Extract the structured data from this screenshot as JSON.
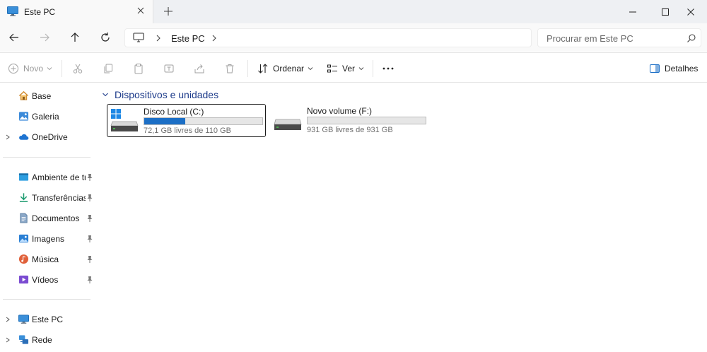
{
  "window": {
    "tab_title": "Este PC",
    "tab_icon": "this-pc-icon",
    "new_tab_label": "+"
  },
  "nav": {
    "breadcrumb": [
      "Este PC"
    ],
    "search_placeholder": "Procurar em Este PC"
  },
  "commands": {
    "new": "Novo",
    "sort": "Ordenar",
    "view": "Ver",
    "details": "Detalhes"
  },
  "sidebar": {
    "top": [
      {
        "label": "Base",
        "icon": "home-icon"
      },
      {
        "label": "Galeria",
        "icon": "gallery-icon"
      },
      {
        "label": "OneDrive",
        "icon": "onedrive-icon",
        "expandable": true
      }
    ],
    "pinned": [
      {
        "label": "Ambiente de trabalho",
        "icon": "desktop-icon"
      },
      {
        "label": "Transferências",
        "icon": "downloads-icon"
      },
      {
        "label": "Documentos",
        "icon": "documents-icon"
      },
      {
        "label": "Imagens",
        "icon": "pictures-icon"
      },
      {
        "label": "Música",
        "icon": "music-icon"
      },
      {
        "label": "Vídeos",
        "icon": "videos-icon"
      }
    ],
    "bottom": [
      {
        "label": "Este PC",
        "icon": "this-pc-icon",
        "expandable": true
      },
      {
        "label": "Rede",
        "icon": "network-icon",
        "expandable": true
      }
    ]
  },
  "main": {
    "group_title": "Dispositivos e unidades",
    "drives": [
      {
        "name": "Disco Local (C:)",
        "free_text": "72,1 GB livres de 110 GB",
        "used_fraction": 0.345,
        "selected": true,
        "system": true
      },
      {
        "name": "Novo volume (F:)",
        "free_text": "931 GB livres de 931 GB",
        "used_fraction": 0.0,
        "selected": false,
        "system": false
      }
    ]
  },
  "colors": {
    "accent": "#1c6fc6",
    "group_title": "#1d3b8a"
  }
}
